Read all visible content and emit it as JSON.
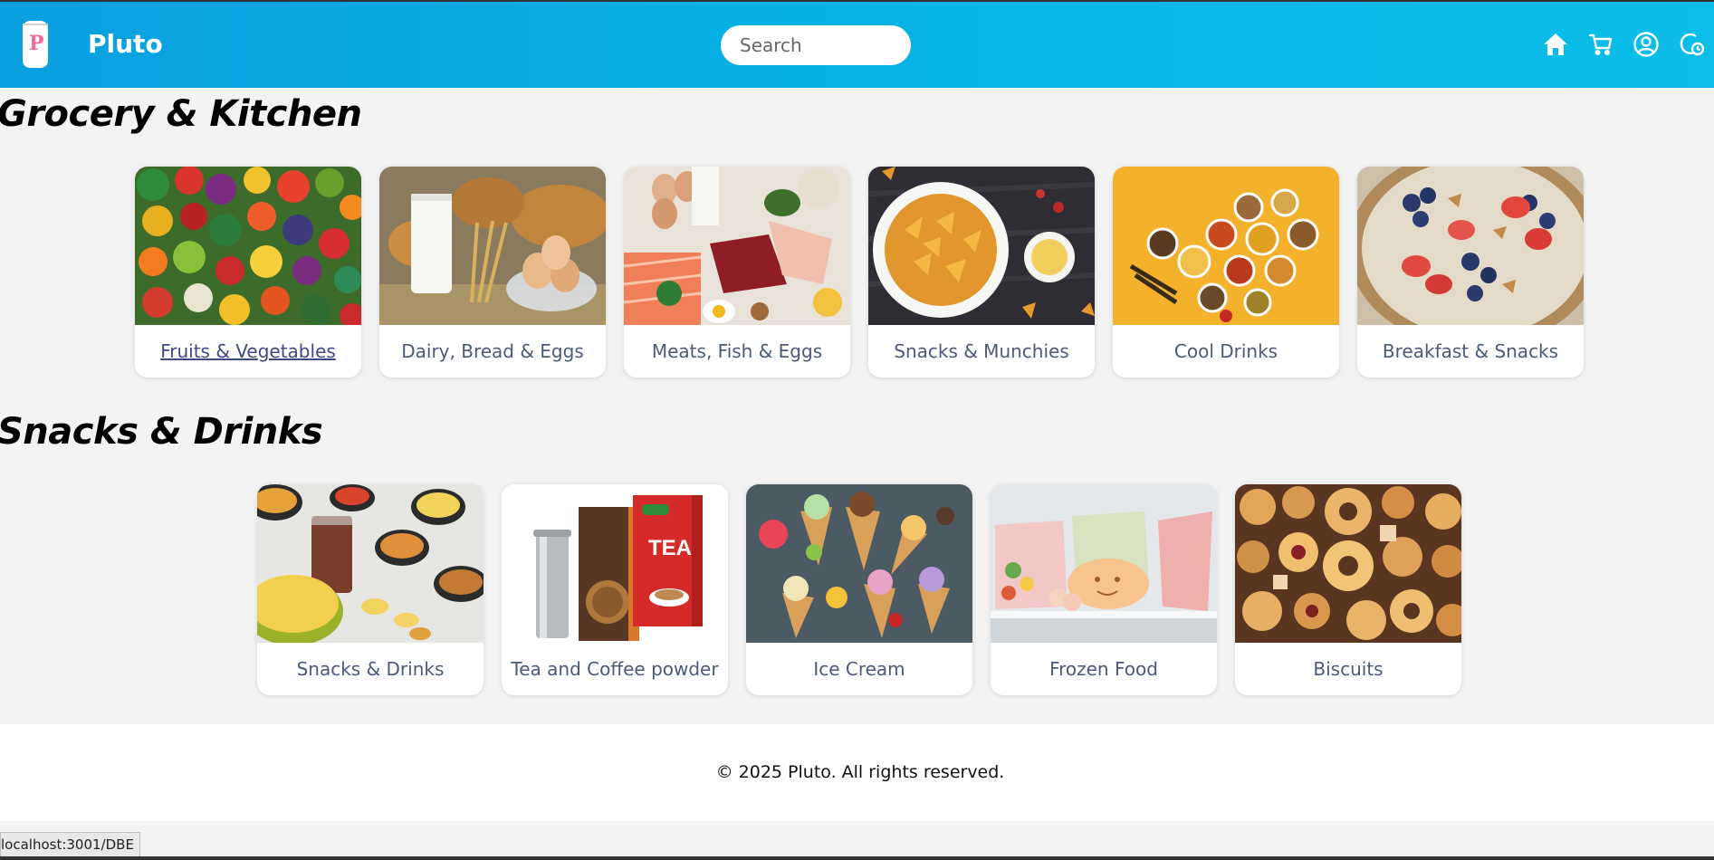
{
  "navbar": {
    "brand": "Pluto",
    "logo_letter": "P",
    "search_placeholder": "Search",
    "icons": [
      "home-icon",
      "cart-icon",
      "user-icon",
      "orders-icon"
    ]
  },
  "sections": [
    {
      "title": "Grocery & Kitchen",
      "categories": [
        {
          "label": "Fruits & Vegetables",
          "hovered": true
        },
        {
          "label": "Dairy, Bread & Eggs"
        },
        {
          "label": "Meats, Fish & Eggs"
        },
        {
          "label": "Snacks & Munchies"
        },
        {
          "label": "Cool Drinks"
        },
        {
          "label": "Breakfast & Snacks"
        }
      ]
    },
    {
      "title": "Snacks & Drinks",
      "categories": [
        {
          "label": "Snacks & Drinks"
        },
        {
          "label": "Tea and Coffee powder"
        },
        {
          "label": "Ice Cream"
        },
        {
          "label": "Frozen Food"
        },
        {
          "label": "Biscuits"
        }
      ]
    }
  ],
  "footer": {
    "text": "© 2025 Pluto. All rights reserved."
  },
  "status_bar": {
    "url": "localhost:3001/DBE"
  },
  "colors": {
    "navbar_start": "#0a9fdf",
    "navbar_end": "#0bbde8",
    "card_label": "#4a5a78",
    "logo_accent": "#f46aa0"
  }
}
